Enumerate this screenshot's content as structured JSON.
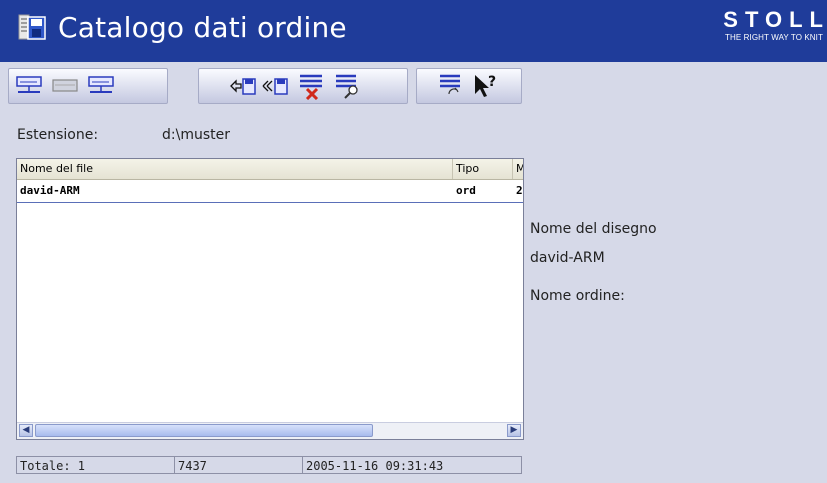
{
  "window": {
    "title": "Catalogo dati ordine",
    "brand": "STOLL",
    "tagline": "THE RIGHT WAY TO KNIT",
    "titlebar_color": "#1f3c9a"
  },
  "toolbar": {
    "group1": [
      "drive-network-icon",
      "drive-local-icon",
      "drive-network2-icon"
    ],
    "group2": [
      "copy-in-icon",
      "copy-out-icon",
      "delete-list-icon",
      "search-list-icon"
    ],
    "group3": [
      "convert-list-icon",
      "help-pointer-icon"
    ]
  },
  "extension": {
    "label": "Estensione:",
    "value": "d:\\muster"
  },
  "list": {
    "columns": [
      "Nome del file",
      "Tipo",
      "M"
    ],
    "rows": [
      {
        "name": "david-ARM",
        "type": "ord",
        "m": "2"
      }
    ]
  },
  "status": {
    "total": "Totale:  1",
    "size": "7437",
    "date": "2005-11-16 09:31:43"
  },
  "details": {
    "design_label": "Nome del disegno",
    "design_value": "david-ARM",
    "order_label": "Nome ordine:"
  }
}
